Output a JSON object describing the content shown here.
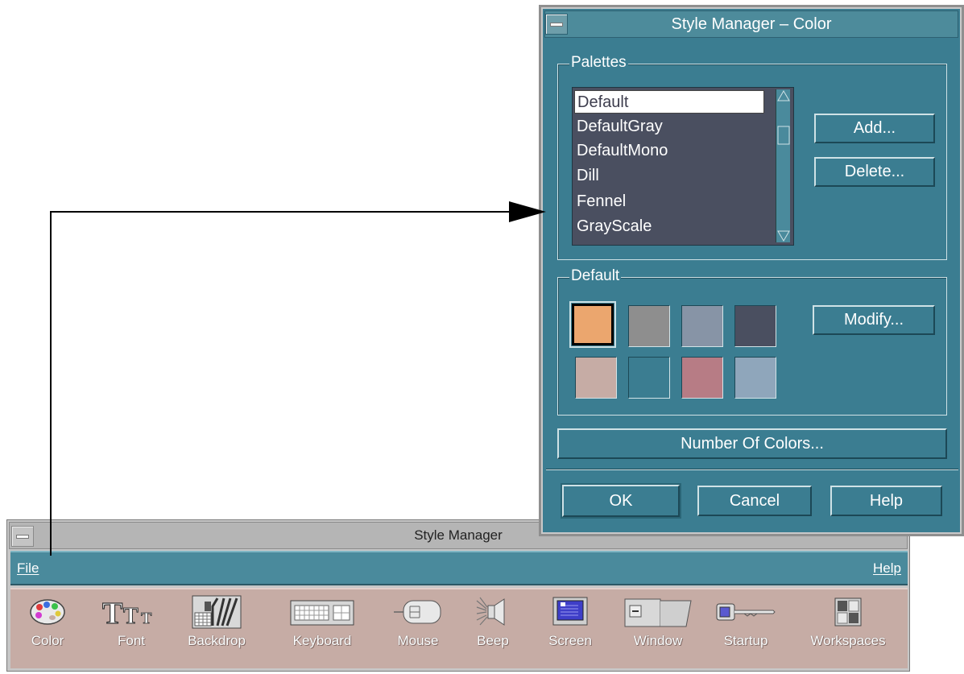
{
  "style_manager": {
    "title": "Style Manager",
    "menu": {
      "file": "File",
      "help": "Help"
    },
    "tools": [
      {
        "id": "color",
        "label": "Color",
        "icon": "palette-icon"
      },
      {
        "id": "font",
        "label": "Font",
        "icon": "font-icon"
      },
      {
        "id": "backdrop",
        "label": "Backdrop",
        "icon": "backdrop-icon"
      },
      {
        "id": "keyboard",
        "label": "Keyboard",
        "icon": "keyboard-icon"
      },
      {
        "id": "mouse",
        "label": "Mouse",
        "icon": "mouse-icon"
      },
      {
        "id": "beep",
        "label": "Beep",
        "icon": "speaker-icon"
      },
      {
        "id": "screen",
        "label": "Screen",
        "icon": "monitor-icon"
      },
      {
        "id": "window",
        "label": "Window",
        "icon": "window-icon"
      },
      {
        "id": "startup",
        "label": "Startup",
        "icon": "key-icon"
      },
      {
        "id": "workspaces",
        "label": "Workspaces",
        "icon": "workspaces-icon"
      }
    ],
    "font_icon_text": "TTT"
  },
  "color_dialog": {
    "title": "Style Manager – Color",
    "palettes": {
      "label": "Palettes",
      "items": [
        "Default",
        "DefaultGray",
        "DefaultMono",
        "Dill",
        "Fennel",
        "GrayScale"
      ],
      "selected": "Default",
      "add_label": "Add...",
      "delete_label": "Delete..."
    },
    "current": {
      "label": "Default",
      "modify_label": "Modify...",
      "swatches": [
        "#eba66e",
        "#8e8e8e",
        "#8794a6",
        "#4a4f60",
        "#c6aca5",
        "#3b7d91",
        "#b77c85",
        "#8fa6bb"
      ],
      "selected_index": 0
    },
    "number_of_colors_label": "Number Of Colors...",
    "ok_label": "OK",
    "cancel_label": "Cancel",
    "help_label": "Help"
  }
}
